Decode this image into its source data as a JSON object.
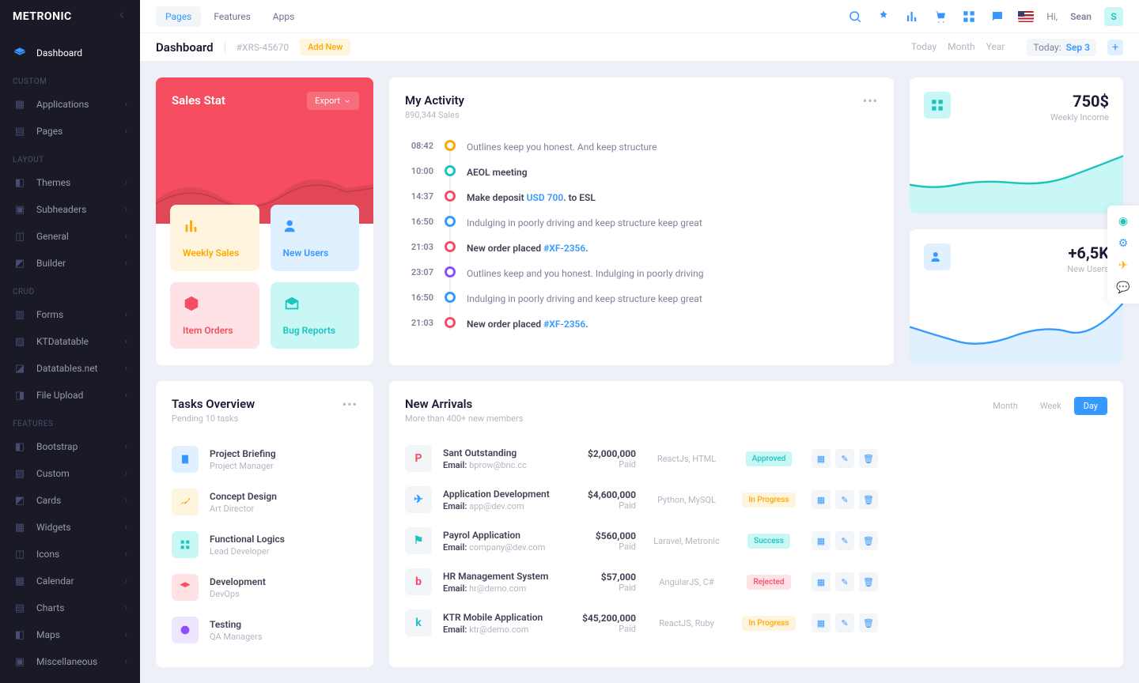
{
  "brand": "METRONIC",
  "topbar": {
    "tabs": [
      "Pages",
      "Features",
      "Apps"
    ],
    "hi": "Hi,",
    "user": "Sean",
    "initial": "S"
  },
  "subheader": {
    "title": "Dashboard",
    "id": "#XRS-45670",
    "addNew": "Add New",
    "filters": [
      "Today",
      "Month",
      "Year"
    ],
    "todayLabel": "Today:",
    "todayDate": "Sep 3"
  },
  "sidebar": {
    "dashboard": "Dashboard",
    "sections": [
      {
        "label": "CUSTOM",
        "items": [
          "Applications",
          "Pages"
        ]
      },
      {
        "label": "LAYOUT",
        "items": [
          "Themes",
          "Subheaders",
          "General",
          "Builder"
        ]
      },
      {
        "label": "CRUD",
        "items": [
          "Forms",
          "KTDatatable",
          "Datatables.net",
          "File Upload"
        ]
      },
      {
        "label": "FEATURES",
        "items": [
          "Bootstrap",
          "Custom",
          "Cards",
          "Widgets",
          "Icons",
          "Calendar",
          "Charts",
          "Maps",
          "Miscellaneous"
        ]
      }
    ]
  },
  "sales": {
    "title": "Sales Stat",
    "export": "Export",
    "tiles": [
      {
        "label": "Weekly Sales",
        "class": "tile-warning"
      },
      {
        "label": "New Users",
        "class": "tile-primary"
      },
      {
        "label": "Item Orders",
        "class": "tile-danger"
      },
      {
        "label": "Bug Reports",
        "class": "tile-success"
      }
    ]
  },
  "activity": {
    "title": "My Activity",
    "sub": "890,344 Sales",
    "items": [
      {
        "time": "08:42",
        "dot": "dot-warning",
        "text": "Outlines keep you honest. And keep structure"
      },
      {
        "time": "10:00",
        "dot": "dot-success",
        "bold": true,
        "text": "AEOL meeting"
      },
      {
        "time": "14:37",
        "dot": "dot-danger",
        "bold": true,
        "html": "Make deposit <a>USD 700</a>. to ESL"
      },
      {
        "time": "16:50",
        "dot": "dot-primary",
        "text": "Indulging in poorly driving and keep structure keep great"
      },
      {
        "time": "21:03",
        "dot": "dot-danger",
        "bold": true,
        "html": "New order placed <a>#XF-2356</a>."
      },
      {
        "time": "23:07",
        "dot": "dot-info",
        "text": "Outlines keep and you honest. Indulging in poorly driving"
      },
      {
        "time": "16:50",
        "dot": "dot-primary",
        "text": "Indulging in poorly driving and keep structure keep great"
      },
      {
        "time": "21:03",
        "dot": "dot-danger",
        "bold": true,
        "html": "New order placed <a>#XF-2356</a>."
      }
    ]
  },
  "mini": [
    {
      "value": "750$",
      "label": "Weekly Income",
      "color": "teal"
    },
    {
      "value": "+6,5K",
      "label": "New Users",
      "color": "blue"
    }
  ],
  "tasks": {
    "title": "Tasks Overview",
    "sub": "Pending 10 tasks",
    "items": [
      {
        "title": "Project Briefing",
        "sub": "Project Manager",
        "class": "ti-primary"
      },
      {
        "title": "Concept Design",
        "sub": "Art Director",
        "class": "ti-warning"
      },
      {
        "title": "Functional Logics",
        "sub": "Lead Developer",
        "class": "ti-success"
      },
      {
        "title": "Development",
        "sub": "DevOps",
        "class": "ti-danger"
      },
      {
        "title": "Testing",
        "sub": "QA Managers",
        "class": "ti-info"
      }
    ]
  },
  "arrivals": {
    "title": "New Arrivals",
    "sub": "More than 400+ new members",
    "tabs": [
      "Month",
      "Week",
      "Day"
    ],
    "emailLabel": "Email:",
    "paidLabel": "Paid",
    "items": [
      {
        "title": "Sant Outstanding",
        "email": "bprow@bnc.cc",
        "amount": "$2,000,000",
        "tech": "ReactJs, HTML",
        "status": "Approved",
        "badgeClass": "badge-approved",
        "iconColor": "#f64e60",
        "initial": "P"
      },
      {
        "title": "Application Development",
        "email": "app@dev.com",
        "amount": "$4,600,000",
        "tech": "Python, MySQL",
        "status": "In Progress",
        "badgeClass": "badge-progress",
        "iconColor": "#3699ff",
        "initial": "✈"
      },
      {
        "title": "Payrol Application",
        "email": "company@dev.com",
        "amount": "$560,000",
        "tech": "Laravel, Metronic",
        "status": "Success",
        "badgeClass": "badge-success",
        "iconColor": "#1bc5bd",
        "initial": "⚑"
      },
      {
        "title": "HR Management System",
        "email": "hr@demo.com",
        "amount": "$57,000",
        "tech": "AngularJS, C#",
        "status": "Rejected",
        "badgeClass": "badge-rejected",
        "iconColor": "#f64e60",
        "initial": "b"
      },
      {
        "title": "KTR Mobile Application",
        "email": "ktr@demo.com",
        "amount": "$45,200,000",
        "tech": "ReactJS, Ruby",
        "status": "In Progress",
        "badgeClass": "badge-progress",
        "iconColor": "#1bc5bd",
        "initial": "k"
      }
    ]
  }
}
